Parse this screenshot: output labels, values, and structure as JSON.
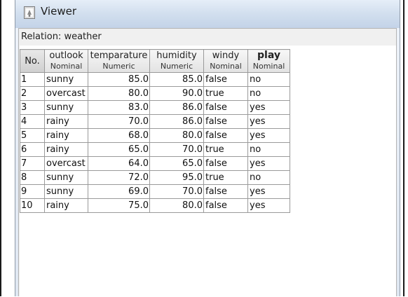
{
  "window": {
    "title": "Viewer"
  },
  "relation_label": "Relation: weather",
  "columns": [
    {
      "name": "No.",
      "type": ""
    },
    {
      "name": "outlook",
      "type": "Nominal"
    },
    {
      "name": "temparature",
      "type": "Numeric"
    },
    {
      "name": "humidity",
      "type": "Numeric"
    },
    {
      "name": "windy",
      "type": "Nominal"
    },
    {
      "name": "play",
      "type": "Nominal"
    }
  ],
  "rows": [
    [
      "1",
      "sunny",
      "85.0",
      "85.0",
      "false",
      "no"
    ],
    [
      "2",
      "overcast",
      "80.0",
      "90.0",
      "true",
      "no"
    ],
    [
      "3",
      "sunny",
      "83.0",
      "86.0",
      "false",
      "yes"
    ],
    [
      "4",
      "rainy",
      "70.0",
      "86.0",
      "false",
      "yes"
    ],
    [
      "5",
      "rainy",
      "68.0",
      "80.0",
      "false",
      "yes"
    ],
    [
      "6",
      "rainy",
      "65.0",
      "70.0",
      "true",
      "no"
    ],
    [
      "7",
      "overcast",
      "64.0",
      "65.0",
      "false",
      "yes"
    ],
    [
      "8",
      "sunny",
      "72.0",
      "95.0",
      "true",
      "no"
    ],
    [
      "9",
      "sunny",
      "69.0",
      "70.0",
      "false",
      "yes"
    ],
    [
      "10",
      "rainy",
      "75.0",
      "80.0",
      "false",
      "yes"
    ]
  ]
}
